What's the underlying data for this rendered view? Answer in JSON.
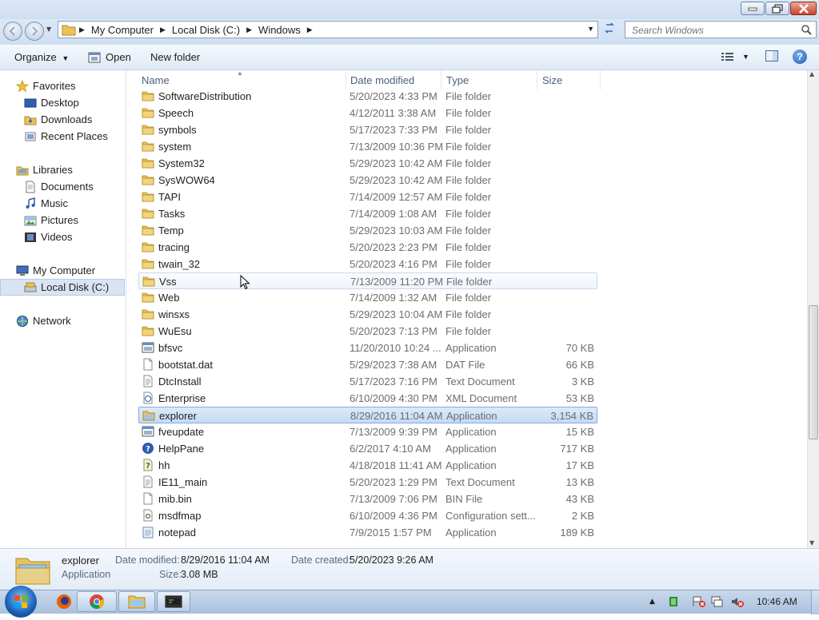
{
  "address": {
    "crumbs": [
      "My Computer",
      "Local Disk (C:)",
      "Windows"
    ],
    "search_placeholder": "Search Windows"
  },
  "toolbar": {
    "organize_label": "Organize",
    "open_label": "Open",
    "new_folder_label": "New folder"
  },
  "nav": {
    "favorites": "Favorites",
    "desktop": "Desktop",
    "downloads": "Downloads",
    "recent_places": "Recent Places",
    "libraries": "Libraries",
    "documents": "Documents",
    "music": "Music",
    "pictures": "Pictures",
    "videos": "Videos",
    "my_computer": "My Computer",
    "local_disk": "Local Disk (C:)",
    "network": "Network"
  },
  "columns": {
    "name": "Name",
    "date": "Date modified",
    "type": "Type",
    "size": "Size"
  },
  "rows": [
    {
      "name": "SoftwareDistribution",
      "date": "5/20/2023 4:33 PM",
      "type": "File folder",
      "size": "",
      "icon": "folder-icon"
    },
    {
      "name": "Speech",
      "date": "4/12/2011 3:38 AM",
      "type": "File folder",
      "size": "",
      "icon": "folder-icon"
    },
    {
      "name": "symbols",
      "date": "5/17/2023 7:33 PM",
      "type": "File folder",
      "size": "",
      "icon": "folder-icon"
    },
    {
      "name": "system",
      "date": "7/13/2009 10:36 PM",
      "type": "File folder",
      "size": "",
      "icon": "folder-icon"
    },
    {
      "name": "System32",
      "date": "5/29/2023 10:42 AM",
      "type": "File folder",
      "size": "",
      "icon": "folder-icon"
    },
    {
      "name": "SysWOW64",
      "date": "5/29/2023 10:42 AM",
      "type": "File folder",
      "size": "",
      "icon": "folder-icon"
    },
    {
      "name": "TAPI",
      "date": "7/14/2009 12:57 AM",
      "type": "File folder",
      "size": "",
      "icon": "folder-icon"
    },
    {
      "name": "Tasks",
      "date": "7/14/2009 1:08 AM",
      "type": "File folder",
      "size": "",
      "icon": "folder-icon"
    },
    {
      "name": "Temp",
      "date": "5/29/2023 10:03 AM",
      "type": "File folder",
      "size": "",
      "icon": "folder-icon"
    },
    {
      "name": "tracing",
      "date": "5/20/2023 2:23 PM",
      "type": "File folder",
      "size": "",
      "icon": "folder-icon"
    },
    {
      "name": "twain_32",
      "date": "5/20/2023 4:16 PM",
      "type": "File folder",
      "size": "",
      "icon": "folder-icon"
    },
    {
      "name": "Vss",
      "date": "7/13/2009 11:20 PM",
      "type": "File folder",
      "size": "",
      "icon": "folder-icon",
      "state": "hover"
    },
    {
      "name": "Web",
      "date": "7/14/2009 1:32 AM",
      "type": "File folder",
      "size": "",
      "icon": "folder-icon"
    },
    {
      "name": "winsxs",
      "date": "5/29/2023 10:04 AM",
      "type": "File folder",
      "size": "",
      "icon": "folder-icon"
    },
    {
      "name": "WuEsu",
      "date": "5/20/2023 7:13 PM",
      "type": "File folder",
      "size": "",
      "icon": "folder-icon"
    },
    {
      "name": "bfsvc",
      "date": "11/20/2010 10:24 ...",
      "type": "Application",
      "size": "70 KB",
      "icon": "application-icon"
    },
    {
      "name": "bootstat.dat",
      "date": "5/29/2023 7:38 AM",
      "type": "DAT File",
      "size": "66 KB",
      "icon": "file-icon"
    },
    {
      "name": "DtcInstall",
      "date": "5/17/2023 7:16 PM",
      "type": "Text Document",
      "size": "3 KB",
      "icon": "text-file-icon"
    },
    {
      "name": "Enterprise",
      "date": "6/10/2009 4:30 PM",
      "type": "XML Document",
      "size": "53 KB",
      "icon": "xml-file-icon"
    },
    {
      "name": "explorer",
      "date": "8/29/2016 11:04 AM",
      "type": "Application",
      "size": "3,154 KB",
      "icon": "explorer-icon",
      "state": "selected"
    },
    {
      "name": "fveupdate",
      "date": "7/13/2009 9:39 PM",
      "type": "Application",
      "size": "15 KB",
      "icon": "application-icon"
    },
    {
      "name": "HelpPane",
      "date": "6/2/2017 4:10 AM",
      "type": "Application",
      "size": "717 KB",
      "icon": "help-icon"
    },
    {
      "name": "hh",
      "date": "4/18/2018 11:41 AM",
      "type": "Application",
      "size": "17 KB",
      "icon": "help-file-icon"
    },
    {
      "name": "IE11_main",
      "date": "5/20/2023 1:29 PM",
      "type": "Text Document",
      "size": "13 KB",
      "icon": "text-file-icon"
    },
    {
      "name": "mib.bin",
      "date": "7/13/2009 7:06 PM",
      "type": "BIN File",
      "size": "43 KB",
      "icon": "file-icon"
    },
    {
      "name": "msdfmap",
      "date": "6/10/2009 4:36 PM",
      "type": "Configuration sett...",
      "size": "2 KB",
      "icon": "config-file-icon"
    },
    {
      "name": "notepad",
      "date": "7/9/2015 1:57 PM",
      "type": "Application",
      "size": "189 KB",
      "icon": "notepad-icon"
    }
  ],
  "details": {
    "name": "explorer",
    "kind": "Application",
    "date_modified_label": "Date modified:",
    "date_modified": "8/29/2016 11:04 AM",
    "date_created_label": "Date created:",
    "date_created": "5/20/2023 9:26 AM",
    "size_label": "Size:",
    "size": "3.08 MB"
  },
  "scroll_fraction": 0.49,
  "taskbar": {
    "clock": "10:46 AM"
  }
}
